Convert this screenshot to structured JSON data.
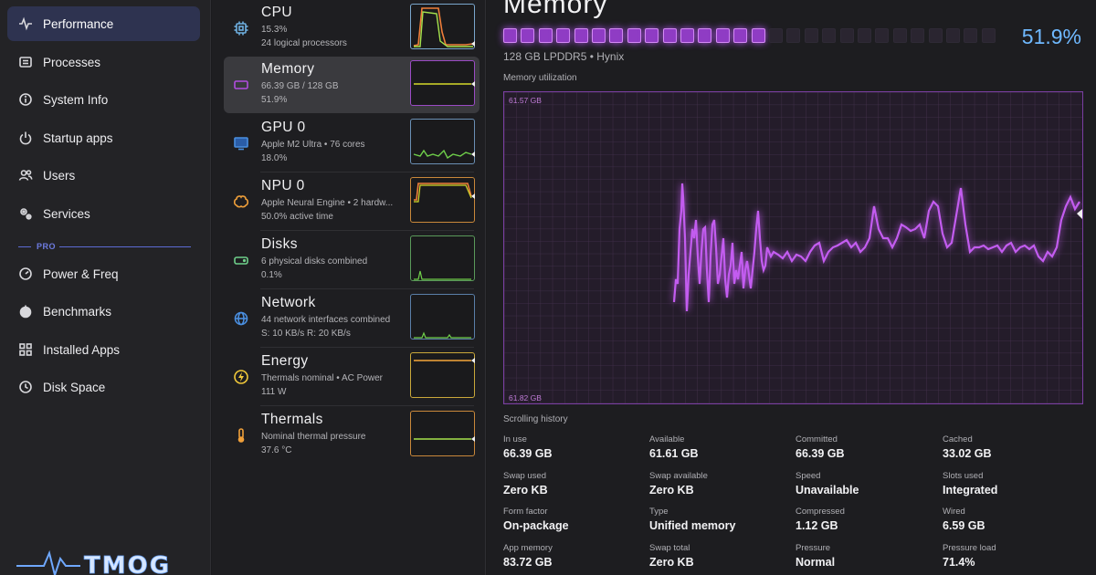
{
  "colors": {
    "accent": "#2e3350",
    "memory": "#b24de0",
    "percent": "#6fb9ff",
    "cpu_line": "#f4a63a",
    "cpu_line2": "#a6e34d",
    "gpu_line": "#6fcf4a",
    "npu_line": "#f07f3a",
    "yellow_line": "#d4d92a"
  },
  "sidebar": {
    "items": [
      {
        "label": "Performance",
        "icon": "pulse-icon"
      },
      {
        "label": "Processes",
        "icon": "list-icon"
      },
      {
        "label": "System Info",
        "icon": "info-icon"
      },
      {
        "label": "Startup apps",
        "icon": "power-icon"
      },
      {
        "label": "Users",
        "icon": "users-icon"
      },
      {
        "label": "Services",
        "icon": "gears-icon"
      }
    ],
    "section_label": "PRO",
    "pro_items": [
      {
        "label": "Power & Freq",
        "icon": "gauge-icon"
      },
      {
        "label": "Benchmarks",
        "icon": "stopwatch-icon"
      },
      {
        "label": "Installed Apps",
        "icon": "grid-icon"
      },
      {
        "label": "Disk Space",
        "icon": "clock-icon"
      }
    ]
  },
  "devices": [
    {
      "name": "CPU",
      "sub1": "15.3%",
      "sub2": "24 logical processors",
      "icon": "chip-icon"
    },
    {
      "name": "Memory",
      "sub1": "66.39 GB / 128 GB",
      "sub2": "51.9%",
      "icon": "memory-icon"
    },
    {
      "name": "GPU 0",
      "sub1": "Apple M2 Ultra • 76 cores",
      "sub2": "18.0%",
      "icon": "monitor-icon"
    },
    {
      "name": "NPU 0",
      "sub1": "Apple Neural Engine • 2 hardw...",
      "sub2": "50.0% active time",
      "icon": "brain-icon"
    },
    {
      "name": "Disks",
      "sub1": "6 physical disks combined",
      "sub2": "0.1%",
      "icon": "disk-icon"
    },
    {
      "name": "Network",
      "sub1": "44 network interfaces combined",
      "sub2": "S: 10 KB/s  R: 20 KB/s",
      "icon": "globe-icon"
    },
    {
      "name": "Energy",
      "sub1": "Thermals nominal • AC Power",
      "sub2": "111 W",
      "icon": "bolt-icon"
    },
    {
      "name": "Thermals",
      "sub1": "Nominal thermal pressure",
      "sub2": "37.6 °C",
      "icon": "thermometer-icon"
    }
  ],
  "detail": {
    "title": "Memory",
    "percent": "51.9%",
    "usage_fraction": 0.519,
    "spec": "128 GB LPDDR5 • Hynix",
    "graph_label": "Memory utilization",
    "graph_max": "61.57 GB",
    "graph_min": "61.82 GB",
    "history_label": "Scrolling history",
    "stats": [
      {
        "label": "In use",
        "value": "66.39 GB"
      },
      {
        "label": "Available",
        "value": "61.61 GB"
      },
      {
        "label": "Committed",
        "value": "66.39 GB"
      },
      {
        "label": "Cached",
        "value": "33.02 GB"
      },
      {
        "label": "Swap used",
        "value": "Zero KB"
      },
      {
        "label": "Swap available",
        "value": "Zero KB"
      },
      {
        "label": "Speed",
        "value": "Unavailable"
      },
      {
        "label": "Slots used",
        "value": "Integrated"
      },
      {
        "label": "Form factor",
        "value": "On-package"
      },
      {
        "label": "Type",
        "value": "Unified memory"
      },
      {
        "label": "Compressed",
        "value": "1.12 GB"
      },
      {
        "label": "Wired",
        "value": "6.59 GB"
      },
      {
        "label": "App memory",
        "value": "83.72 GB"
      },
      {
        "label": "Swap total",
        "value": "Zero KB"
      },
      {
        "label": "Pressure",
        "value": "Normal"
      },
      {
        "label": "Pressure load",
        "value": "71.4%"
      }
    ]
  }
}
